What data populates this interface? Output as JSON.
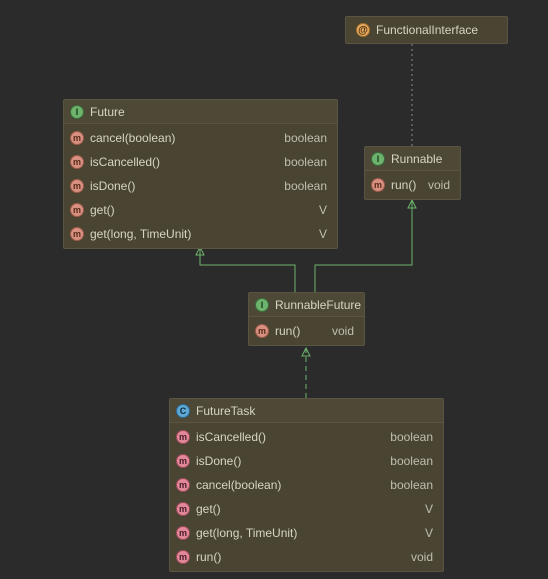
{
  "annotation": {
    "label": "FunctionalInterface"
  },
  "future": {
    "title": "Future",
    "members": [
      {
        "sig": "cancel(boolean)",
        "ret": "boolean"
      },
      {
        "sig": "isCancelled()",
        "ret": "boolean"
      },
      {
        "sig": "isDone()",
        "ret": "boolean"
      },
      {
        "sig": "get()",
        "ret": "V"
      },
      {
        "sig": "get(long, TimeUnit)",
        "ret": "V"
      }
    ]
  },
  "runnable": {
    "title": "Runnable",
    "members": [
      {
        "sig": "run()",
        "ret": "void"
      }
    ]
  },
  "runnableFuture": {
    "title": "RunnableFuture",
    "members": [
      {
        "sig": "run()",
        "ret": "void"
      }
    ]
  },
  "futureTask": {
    "title": "FutureTask",
    "members": [
      {
        "sig": "isCancelled()",
        "ret": "boolean"
      },
      {
        "sig": "isDone()",
        "ret": "boolean"
      },
      {
        "sig": "cancel(boolean)",
        "ret": "boolean"
      },
      {
        "sig": "get()",
        "ret": "V"
      },
      {
        "sig": "get(long, TimeUnit)",
        "ret": "V"
      },
      {
        "sig": "run()",
        "ret": "void"
      }
    ]
  }
}
